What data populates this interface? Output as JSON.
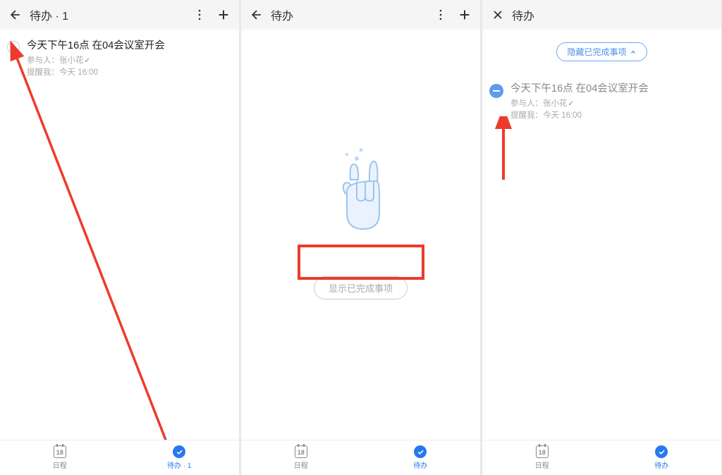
{
  "screens": {
    "one": {
      "header": {
        "title": "待办 · 1"
      },
      "todo": {
        "title": "今天下午16点 在04会议室开会",
        "participants_label": "参与人：",
        "participants_value": "张小花",
        "remind_label": "提醒我：",
        "remind_value": "今天 16:00"
      },
      "nav": {
        "calendar": {
          "label": "日程",
          "date": "18"
        },
        "todo": {
          "label": "待办 · 1"
        }
      }
    },
    "two": {
      "header": {
        "title": "待办"
      },
      "empty": {
        "show_btn": "显示已完成事项"
      },
      "nav": {
        "calendar": {
          "label": "日程",
          "date": "18"
        },
        "todo": {
          "label": "待办"
        }
      }
    },
    "three": {
      "header": {
        "title": "待办"
      },
      "hide_btn": "隐藏已完成事项",
      "todo": {
        "title": "今天下午16点 在04会议室开会",
        "participants_label": "参与人：",
        "participants_value": "张小花",
        "remind_label": "提醒我：",
        "remind_value": "今天 16:00"
      },
      "nav": {
        "calendar": {
          "label": "日程",
          "date": "18"
        },
        "todo": {
          "label": "待办"
        }
      }
    }
  }
}
